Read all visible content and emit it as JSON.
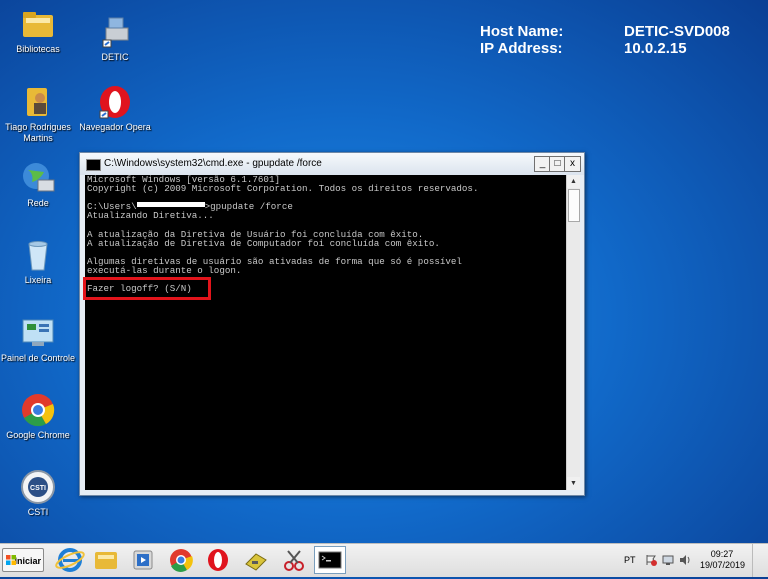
{
  "bginfo": {
    "host_label": "Host Name:",
    "host_value": "DETIC-SVD008",
    "ip_label": "IP Address:",
    "ip_value": "10.0.2.15"
  },
  "desktop_icons": {
    "bibliotecas": "Bibliotecas",
    "detic": "DETIC",
    "user_line1": "Tiago Rodrigues",
    "user_line2": "Martins",
    "opera": "Navegador Opera",
    "rede": "Rede",
    "lixeira": "Lixeira",
    "painel": "Painel de Controle",
    "chrome": "Google Chrome",
    "csti": "CSTI"
  },
  "cmd_window": {
    "title": "C:\\Windows\\system32\\cmd.exe - gpupdate  /force",
    "btn_min": "_",
    "btn_max": "□",
    "btn_close": "x",
    "scroll_up": "▲",
    "scroll_down": "▼",
    "lines": [
      "Microsoft Windows [versão 6.1.7601]",
      "Copyright (c) 2009 Microsoft Corporation. Todos os direitos reservados.",
      "",
      "",
      "Atualizando Diretiva...",
      "",
      "A atualização da Diretiva de Usuário foi concluída com êxito.",
      "A atualização de Diretiva de Computador foi concluída com êxito.",
      "",
      "Algumas diretivas de usuário são ativadas de forma que só é possível",
      "executá-las durante o logon.",
      "",
      "Fazer logoff? (S/N)"
    ],
    "prompt_prefix": "C:\\Users\\",
    "prompt_command": ">gpupdate /force"
  },
  "taskbar": {
    "start_label": "Iniciar",
    "lang": "PT",
    "time": "09:27",
    "date": "19/07/2019"
  },
  "colors": {
    "highlight": "#e2141b",
    "console_bg": "#000000",
    "console_text": "#c8c8c8"
  }
}
